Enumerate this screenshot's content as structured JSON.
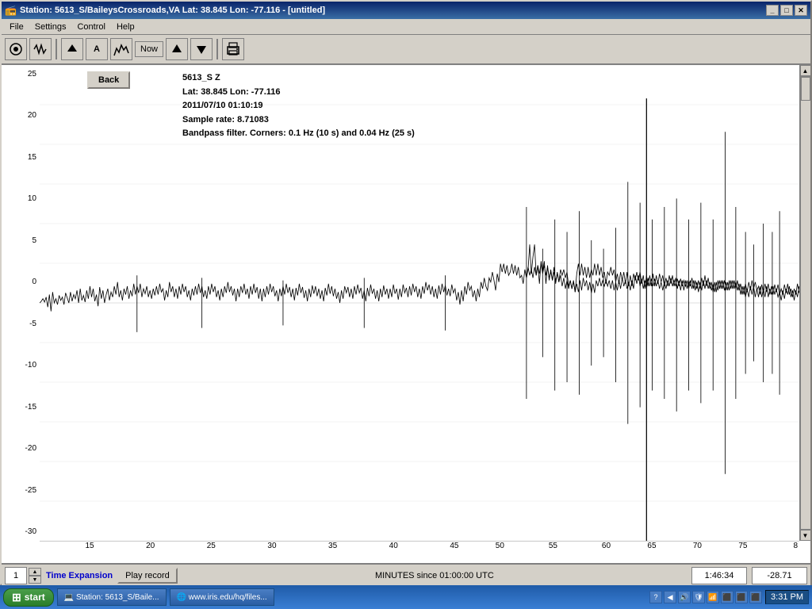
{
  "titlebar": {
    "title": "Station: 5613_S/BaileysCrossroads,VA Lat: 38.845 Lon: -77.116 - [untitled]",
    "min_label": "_",
    "max_label": "□",
    "close_label": "✕"
  },
  "menubar": {
    "items": [
      "File",
      "Settings",
      "Control",
      "Help"
    ]
  },
  "toolbar": {
    "icons": [
      "📻",
      "🔊",
      "〰",
      "⬆",
      "📄",
      "⬇",
      "▶"
    ],
    "now_label": "Now",
    "up_arrow": "▲",
    "down_arrow": "▼",
    "print_icon": "🖨"
  },
  "chart": {
    "back_label": "Back",
    "info": {
      "station": "5613_S  Z",
      "lat_lon": "Lat: 38.845 Lon: -77.116",
      "datetime": "2011/07/10  01:10:19",
      "sample_rate": "Sample rate: 8.71083",
      "bandpass": "Bandpass filter. Corners: 0.1 Hz (10 s) and 0.04 Hz (25 s)"
    },
    "y_labels": [
      "25",
      "20",
      "15",
      "10",
      "5",
      "0",
      "-5",
      "-10",
      "-15",
      "-20",
      "-25",
      "-30"
    ],
    "x_labels": [
      "15",
      "20",
      "25",
      "30",
      "35",
      "40",
      "45",
      "50",
      "55",
      "60",
      "65",
      "70",
      "75",
      "8"
    ]
  },
  "status_bar": {
    "spinner_value": "1",
    "time_expansion_label": "Time Expansion",
    "play_record_label": "Play record",
    "minutes_label": "MINUTES since 01:00:00 UTC",
    "time_value": "1:46:34",
    "amplitude_value": "-28.71"
  },
  "taskbar": {
    "start_label": "start",
    "items": [
      {
        "label": "Station: 5613_S/Baile...",
        "icon": "💻"
      },
      {
        "label": "www.iris.edu/hq/files...",
        "icon": "🌐"
      }
    ],
    "sys_icons": [
      "?",
      "◀",
      "🔊",
      "🛡",
      "📶",
      "⬛",
      "⬛",
      "⬛"
    ],
    "clock": "3:31 PM"
  }
}
